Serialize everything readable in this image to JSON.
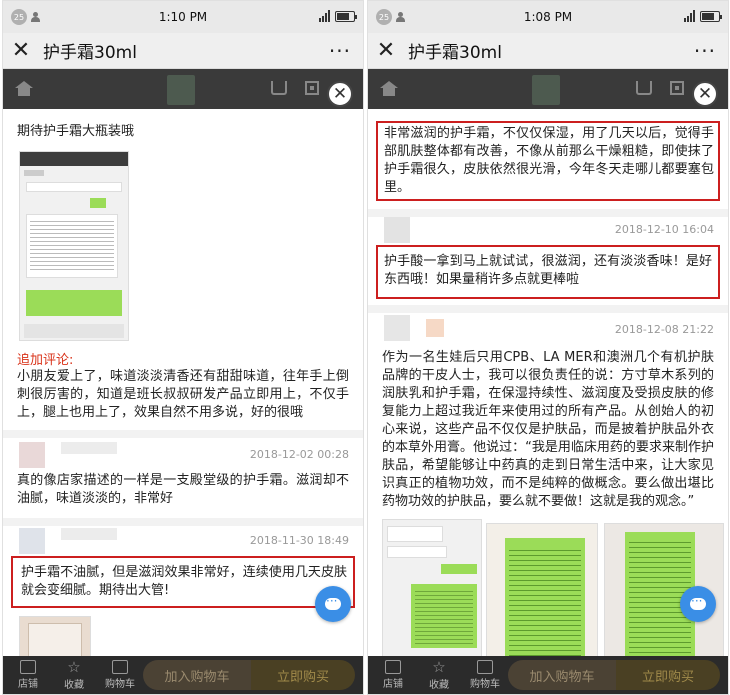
{
  "left_phone": {
    "status": {
      "badge": "25",
      "time": "1:10 PM"
    },
    "nav": {
      "title": "护手霜30ml",
      "more": "···"
    },
    "review1": {
      "text": "期待护手霜大瓶装哦",
      "followup_label": "追加评论:",
      "followup_text": "小朋友爱上了，味道淡淡清香还有甜甜味道，往年手上倒刺很厉害的，知道是班长叔叔研发产品立即用上，不仅手上，腿上也用上了，效果自然不用多说，好的很哦"
    },
    "review2": {
      "date": "2018-12-02 00:28",
      "text": "真的像店家描述的一样是一支殿堂级的护手霜。滋润却不油腻，味道淡淡的，非常好"
    },
    "review3": {
      "date": "2018-11-30 18:49",
      "text": "护手霜不油腻，但是滋润效果非常好，连续使用几天皮肤就会变细腻。期待出大管!"
    },
    "bottom": {
      "store": "店铺",
      "favorite": "收藏",
      "cart": "购物车",
      "add_cart": "加入购物车",
      "buy_now": "立即购买"
    }
  },
  "right_phone": {
    "status": {
      "badge": "25",
      "time": "1:08 PM"
    },
    "nav": {
      "title": "护手霜30ml",
      "more": "···"
    },
    "review1": {
      "text": "非常滋润的护手霜，不仅仅保湿，用了几天以后，觉得手部肌肤整体都有改善，不像从前那么干燥粗糙，即使抹了护手霜很久，皮肤依然很光滑，今年冬天走哪儿都要塞包里。"
    },
    "review2": {
      "date": "2018-12-10 16:04",
      "text": "护手酸一拿到马上就试试，很滋润，还有淡淡香味！是好东西哦！如果量稍许多点就更棒啦"
    },
    "review3": {
      "date": "2018-12-08 21:22",
      "text": "作为一名生娃后只用CPB、LA MER和澳洲几个有机护肤品牌的干皮人士，我可以很负责任的说：方寸草木系列的润肤乳和护手霜，在保湿持续性、滋润度及受损皮肤的修复能力上超过我近年来使用过的所有产品。从创始人的初心来说，这些产品不仅仅是护肤品，而是披着护肤品外衣的本草外用膏。他说过：“我是用临床用药的要求来制作护肤品，希望能够让中药真的走到日常生活中来，让大家见识真正的植物功效，而不是纯粹的做概念。要么做出堪比药物功效的护肤品，要么就不要做！这就是我的观念。”"
    },
    "bottom": {
      "store": "店铺",
      "favorite": "收藏",
      "cart": "购物车",
      "add_cart": "加入购物车",
      "buy_now": "立即购买"
    }
  },
  "colors": {
    "highlight_border": "#cc1f1f",
    "followup_red": "#d9331a",
    "fab_blue": "#3a8ee6",
    "bottom_bar": "#2b2b2b"
  },
  "icons": [
    "close-icon",
    "more-icon",
    "home-icon",
    "cart-icon",
    "qr-icon",
    "dismiss-icon",
    "store-icon",
    "star-icon",
    "chat-icon"
  ]
}
